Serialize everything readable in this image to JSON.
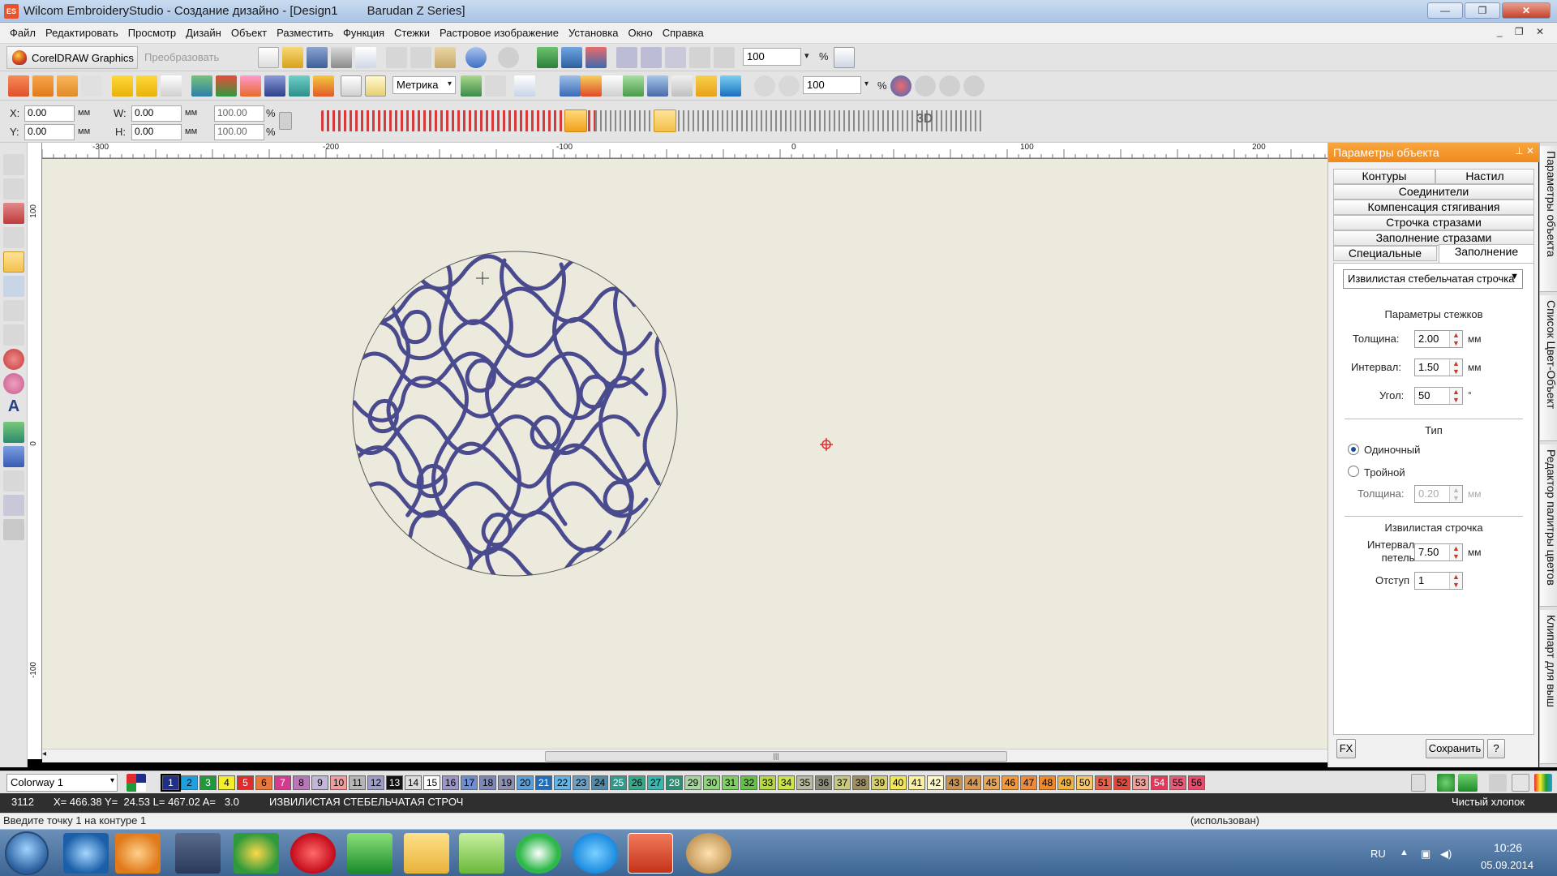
{
  "window": {
    "title": "Wilcom EmbroideryStudio - Создание дизайно - [Design1",
    "machine": "Barudan Z Series]",
    "minimize": "—",
    "restore": "❐",
    "close": "✕"
  },
  "menu": [
    "Файл",
    "Редактировать",
    "Просмотр",
    "Дизайн",
    "Объект",
    "Разместить",
    "Функция",
    "Стежки",
    "Растровое изображение",
    "Установка",
    "Окно",
    "Справка"
  ],
  "toolbar": {
    "corel": "CorelDRAW Graphics",
    "convert": "Преобразовать",
    "zoom1": "100",
    "zoom1_unit": "%",
    "units": "Метрика",
    "zoom2": "100",
    "zoom2_unit": "%"
  },
  "props": {
    "x_label": "X:",
    "x": "0.00",
    "y_label": "Y:",
    "y": "0.00",
    "w_label": "W:",
    "w": "0.00",
    "h_label": "H:",
    "h": "0.00",
    "unit": "мм",
    "scale_w": "100.00",
    "scale_h": "100.00",
    "pct": "%"
  },
  "ruler": {
    "h_labels": [
      "-300",
      "-200",
      "-100",
      "0",
      "100",
      "200"
    ],
    "v_labels": [
      "100",
      "0",
      "-100"
    ]
  },
  "panel": {
    "title": "Параметры объекта",
    "tabs": [
      "Контуры",
      "Настил",
      "Соединители",
      "Компенсация стягивания",
      "Строчка стразами",
      "Заполнение стразами",
      "Специальные",
      "Заполнение"
    ],
    "fill_type": "Извилистая стебельчатая строчка",
    "stitch_params": "Параметры стежков",
    "thickness_label": "Толщина:",
    "thickness": "2.00",
    "thickness_unit": "мм",
    "interval_label": "Интервал:",
    "interval": "1.50",
    "interval_unit": "мм",
    "angle_label": "Угол:",
    "angle": "50",
    "angle_unit": "°",
    "type_title": "Тип",
    "single": "Одиночный",
    "triple": "Тройной",
    "triple_thick_label": "Толщина:",
    "triple_thick": "0.20",
    "triple_thick_unit": "мм",
    "wavy_title": "Извилистая строчка",
    "loop_label_1": "Интервал",
    "loop_label_2": "петель",
    "loop": "7.50",
    "loop_unit": "мм",
    "offset_label": "Отступ",
    "offset": "1",
    "fx": "FX",
    "save": "Сохранить",
    "help": "?"
  },
  "side_tabs": [
    "Параметры объекта",
    "Список Цвет-Объект",
    "Редактор палитры цветов",
    "Клипарт для выш"
  ],
  "colorway": "Colorway 1",
  "swatches": [
    {
      "n": "1",
      "c": "#1f2e8a"
    },
    {
      "n": "2",
      "c": "#1e9fe0"
    },
    {
      "n": "3",
      "c": "#1f9a3b"
    },
    {
      "n": "4",
      "c": "#f5ee2a"
    },
    {
      "n": "5",
      "c": "#e22b2b"
    },
    {
      "n": "6",
      "c": "#e9763a"
    },
    {
      "n": "7",
      "c": "#d63a8f"
    },
    {
      "n": "8",
      "c": "#b876b6"
    },
    {
      "n": "9",
      "c": "#c3b6d9"
    },
    {
      "n": "10",
      "c": "#f19c9c"
    },
    {
      "n": "11",
      "c": "#b5b5b5"
    },
    {
      "n": "12",
      "c": "#9c9cc9"
    },
    {
      "n": "13",
      "c": "#111111"
    },
    {
      "n": "14",
      "c": "#dcdcdc"
    },
    {
      "n": "15",
      "c": "#ffffff"
    },
    {
      "n": "16",
      "c": "#9b96c8"
    },
    {
      "n": "17",
      "c": "#6f8ed0"
    },
    {
      "n": "18",
      "c": "#7b88b8"
    },
    {
      "n": "19",
      "c": "#8d8fb0"
    },
    {
      "n": "20",
      "c": "#5aa0d8"
    },
    {
      "n": "21",
      "c": "#1b6fc0"
    },
    {
      "n": "22",
      "c": "#5fb5e6"
    },
    {
      "n": "23",
      "c": "#6aa0c4"
    },
    {
      "n": "24",
      "c": "#4f8aa8"
    },
    {
      "n": "25",
      "c": "#2f9a8e"
    },
    {
      "n": "26",
      "c": "#37a88a"
    },
    {
      "n": "27",
      "c": "#37b7b0"
    },
    {
      "n": "28",
      "c": "#2c8f74"
    },
    {
      "n": "29",
      "c": "#a9d6a0"
    },
    {
      "n": "30",
      "c": "#8fd47a"
    },
    {
      "n": "31",
      "c": "#7fcf62"
    },
    {
      "n": "32",
      "c": "#66c04a"
    },
    {
      "n": "33",
      "c": "#b5d93f"
    },
    {
      "n": "34",
      "c": "#cce44a"
    },
    {
      "n": "35",
      "c": "#b9b9a0"
    },
    {
      "n": "36",
      "c": "#8b8b7a"
    },
    {
      "n": "37",
      "c": "#c9c980"
    },
    {
      "n": "38",
      "c": "#9d9060"
    },
    {
      "n": "39",
      "c": "#d8d06b"
    },
    {
      "n": "40",
      "c": "#f1e65a"
    },
    {
      "n": "41",
      "c": "#fbf19a"
    },
    {
      "n": "42",
      "c": "#fff8c8"
    },
    {
      "n": "43",
      "c": "#c9924f"
    },
    {
      "n": "44",
      "c": "#d79a55"
    },
    {
      "n": "45",
      "c": "#e8a456"
    },
    {
      "n": "46",
      "c": "#f09a3b"
    },
    {
      "n": "47",
      "c": "#f08a3b"
    },
    {
      "n": "48",
      "c": "#ef8a2a"
    },
    {
      "n": "49",
      "c": "#f2b23a"
    },
    {
      "n": "50",
      "c": "#f6c86a"
    },
    {
      "n": "51",
      "c": "#e8604a"
    },
    {
      "n": "52",
      "c": "#e0483a"
    },
    {
      "n": "53",
      "c": "#f0a09a"
    },
    {
      "n": "54",
      "c": "#e4385a"
    },
    {
      "n": "55",
      "c": "#ec5a7a"
    },
    {
      "n": "56",
      "c": "#ea4a6a"
    }
  ],
  "status": {
    "stitch_count": "3112",
    "coords": "X= 466.38 Y=  24.53 L= 467.02 A=   3.0",
    "object": "ИЗВИЛИСТАЯ СТЕБЕЛЬЧАТАЯ СТРОЧ",
    "fabric": "Чистый хлопок"
  },
  "prompt": {
    "text": "Введите точку 1 на контуре 1",
    "right": "(использован)"
  },
  "taskbar": {
    "lang": "RU",
    "time": "10:26",
    "date": "05.09.2014"
  }
}
